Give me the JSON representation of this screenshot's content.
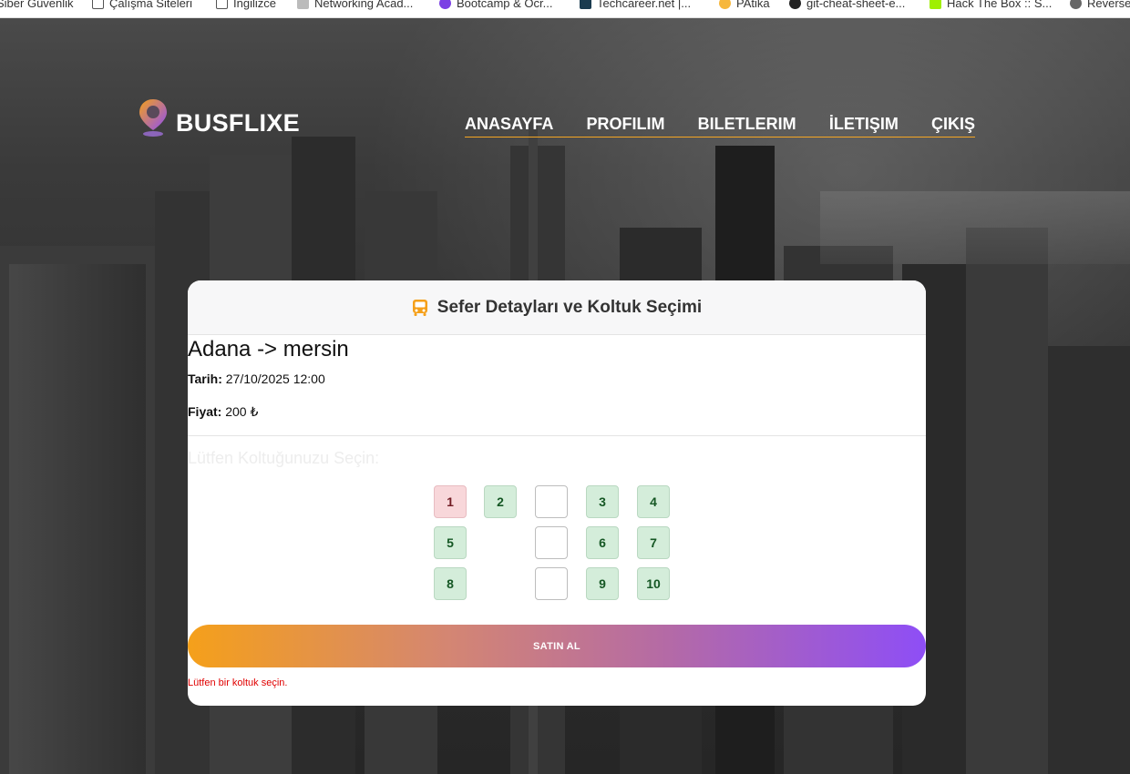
{
  "bookmarks": [
    {
      "label": "Siber Güvenlik",
      "icon": "folder-icon"
    },
    {
      "label": "Çalışma Siteleri",
      "icon": "folder-icon"
    },
    {
      "label": "İngilizce",
      "icon": "folder-icon"
    },
    {
      "label": "Networking Acad...",
      "icon": "cisco-icon"
    },
    {
      "label": "Bootcamp & Öcr...",
      "icon": "bootcamp-icon"
    },
    {
      "label": "Techcareer.net |...",
      "icon": "techcareer-icon"
    },
    {
      "label": "PAtika",
      "icon": "patika-icon"
    },
    {
      "label": "git-cheat-sheet-e...",
      "icon": "github-icon"
    },
    {
      "label": "Hack The Box :: S...",
      "icon": "htb-icon"
    },
    {
      "label": "Reverse",
      "icon": "globe-icon"
    }
  ],
  "brand": {
    "name": "BUSFLIXE",
    "icon": "map-pin-icon"
  },
  "nav": {
    "home": "ANASAYFA",
    "profile": "PROFILIM",
    "tickets": "BILETLERIM",
    "contact": "İLETIŞIM",
    "logout": "ÇIKIŞ"
  },
  "card": {
    "icon": "bus-icon",
    "title": "Sefer Detayları ve Koltuk Seçimi",
    "route": "Adana -> mersin",
    "date_label": "Tarih:",
    "date_value": "27/10/2025 12:00",
    "price_label": "Fiyat:",
    "price_value": "200 ₺",
    "prompt": "Lütfen Koltuğunuzu Seçin:",
    "seats": [
      {
        "number": "1",
        "status": "taken"
      },
      {
        "number": "2",
        "status": "available"
      },
      {
        "number": "3",
        "status": "available"
      },
      {
        "number": "4",
        "status": "available"
      },
      {
        "number": "5",
        "status": "available"
      },
      {
        "number": "6",
        "status": "available"
      },
      {
        "number": "7",
        "status": "available"
      },
      {
        "number": "8",
        "status": "available"
      },
      {
        "number": "9",
        "status": "available"
      },
      {
        "number": "10",
        "status": "available"
      }
    ],
    "buy_button": "SATIN AL",
    "error_message": "Lütfen bir koltuk seçin."
  },
  "colors": {
    "accent_orange": "#f5a01a",
    "accent_purple": "#8e4ef6",
    "seat_available": "#d4edda",
    "seat_taken": "#f8d7da",
    "error": "#e00000"
  }
}
